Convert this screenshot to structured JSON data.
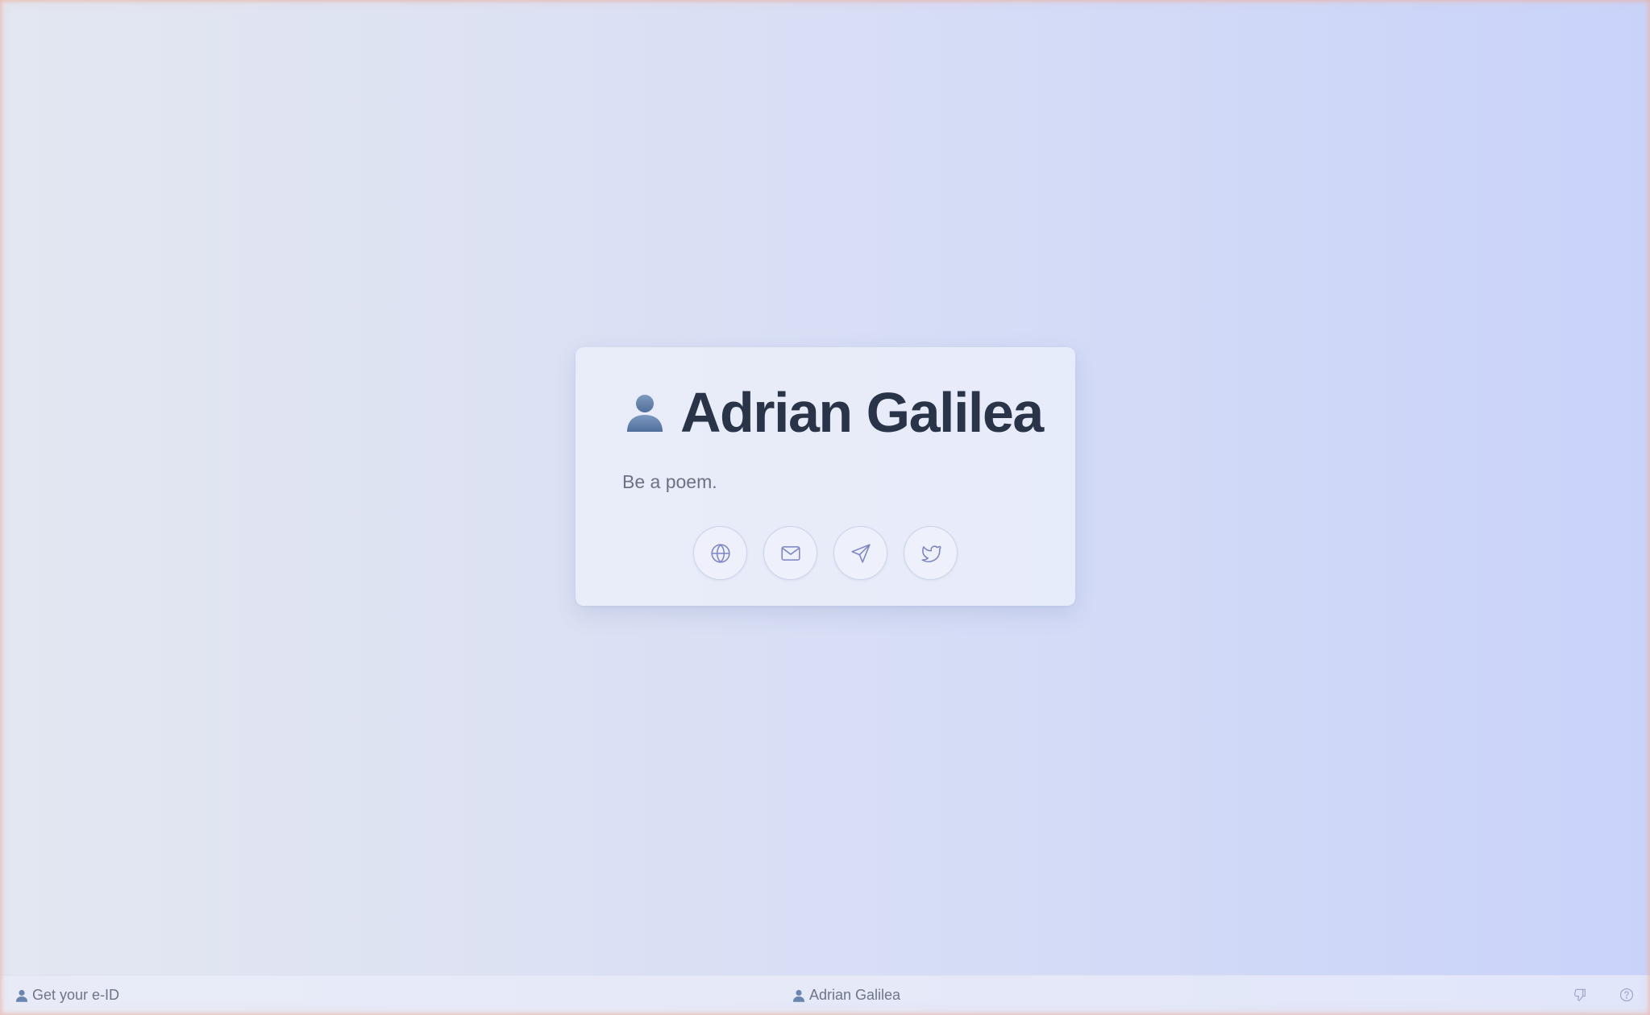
{
  "profile": {
    "name": "Adrian Galilea",
    "tagline": "Be a poem.",
    "avatar_icon": "person-silhouette-icon"
  },
  "socials": [
    {
      "icon": "globe-icon",
      "label": "Website"
    },
    {
      "icon": "mail-icon",
      "label": "Email"
    },
    {
      "icon": "send-icon",
      "label": "Telegram"
    },
    {
      "icon": "twitter-icon",
      "label": "Twitter"
    }
  ],
  "footer": {
    "left_link": "Get your e-ID",
    "center_name": "Adrian Galilea",
    "right_icons": [
      "thumbs-down-icon",
      "help-icon"
    ]
  },
  "colors": {
    "name_text": "#2a3448",
    "icon_stroke": "#7b84c4",
    "avatar": "#6a86b0",
    "background_start": "#e3e7f1",
    "background_end": "#c9d3fa"
  }
}
